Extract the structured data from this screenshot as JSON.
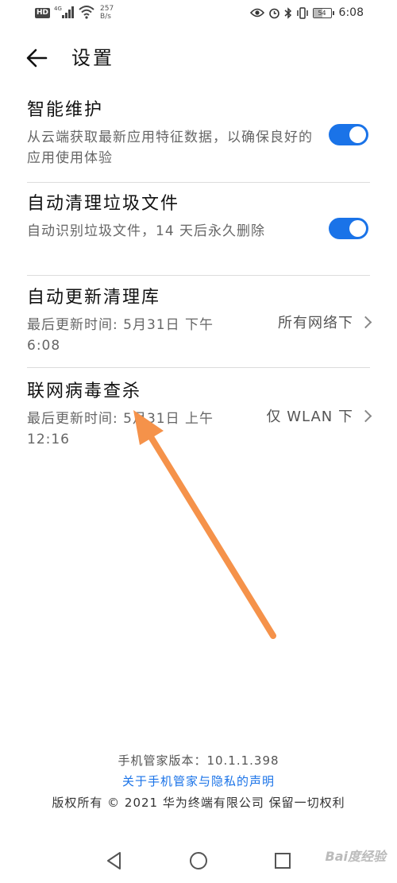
{
  "status_bar": {
    "hd": "HD",
    "net_speed_value": "257",
    "net_speed_unit": "B/s",
    "battery": "54",
    "time": "6:08"
  },
  "header": {
    "title": "设置"
  },
  "settings": [
    {
      "title": "智能维护",
      "subtitle": "从云端获取最新应用特征数据，以确保良好的应用使用体验",
      "toggle_on": true
    },
    {
      "title": "自动清理垃圾文件",
      "subtitle": "自动识别垃圾文件，14 天后永久删除",
      "toggle_on": true
    },
    {
      "title": "自动更新清理库",
      "subtitle": "最后更新时间: 5月31日 下午6:08",
      "value": "所有网络下"
    },
    {
      "title": "联网病毒查杀",
      "subtitle": "最后更新时间: 5月31日 上午12:16",
      "value": "仅 WLAN 下"
    }
  ],
  "footer": {
    "version": "手机管家版本：10.1.1.398",
    "privacy_link": "关于手机管家与隐私的声明",
    "copyright": "版权所有 © 2021 华为终端有限公司 保留一切权利"
  },
  "watermark": "Bai度经验",
  "colors": {
    "accent": "#1a73e8",
    "annotation_arrow": "#f5924a"
  },
  "icons": {
    "back": "arrow-left-icon",
    "nav": [
      "back-triangle-icon",
      "home-circle-icon",
      "recents-square-icon"
    ]
  }
}
